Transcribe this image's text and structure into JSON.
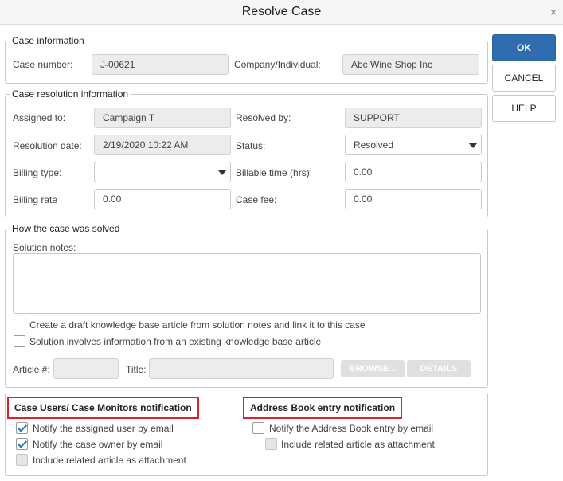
{
  "window": {
    "title": "Resolve Case",
    "close_glyph": "×"
  },
  "buttons": {
    "ok": "OK",
    "cancel": "CANCEL",
    "help": "HELP",
    "browse": "BROWSE...",
    "details": "DETAILS"
  },
  "case_info": {
    "legend": "Case information",
    "case_number_label": "Case number:",
    "case_number": "J-00621",
    "company_label": "Company/Individual:",
    "company": "Abc Wine Shop Inc"
  },
  "resolution": {
    "legend": "Case resolution information",
    "assigned_to_label": "Assigned to:",
    "assigned_to": "Campaign T",
    "resolved_by_label": "Resolved by:",
    "resolved_by": "SUPPORT",
    "resolution_date_label": "Resolution date:",
    "resolution_date": "2/19/2020 10:22 AM",
    "status_label": "Status:",
    "status": "Resolved",
    "billing_type_label": "Billing type:",
    "billing_type": "",
    "billable_time_label": "Billable time (hrs):",
    "billable_time": "0.00",
    "billing_rate_label": "Billing rate",
    "billing_rate": "0.00",
    "case_fee_label": "Case fee:",
    "case_fee": "0.00"
  },
  "solved": {
    "legend": "How the case was solved",
    "solution_notes_label": "Solution notes:",
    "solution_notes": "",
    "create_kb_label": "Create a draft knowledge base article from solution notes and link it to this case",
    "existing_kb_label": "Solution involves information from an existing knowledge base article",
    "article_label": "Article #:",
    "title_label": "Title:"
  },
  "notifications": {
    "case_users_title": "Case Users/ Case Monitors notification",
    "notify_assigned": "Notify the assigned user by email",
    "notify_owner": "Notify the case owner by email",
    "include_article_left": "Include related article as attachment",
    "address_book_title": "Address Book entry notification",
    "notify_address_book": "Notify the Address Book entry by email",
    "include_article_right": "Include related article as attachment"
  },
  "colors": {
    "primary": "#2f6db0",
    "highlight_border": "#d8232a",
    "checkmark": "#1f6fb4"
  }
}
